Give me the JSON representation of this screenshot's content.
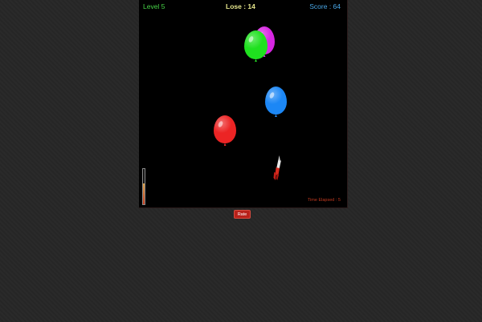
{
  "hud": {
    "level": "Level 5",
    "lose": "Lose : 14",
    "score": "Score : 64"
  },
  "colors": {
    "level": "#47d547",
    "lose": "#e6e68c",
    "score": "#4aa8e8",
    "time": "#c0391f",
    "rate_button": "#b8211a"
  },
  "balloons": [
    {
      "name": "magenta-balloon",
      "color": "#d726e2"
    },
    {
      "name": "green-balloon",
      "color": "#1fe11f"
    },
    {
      "name": "blue-balloon",
      "color": "#1c87f5"
    },
    {
      "name": "red-balloon",
      "color": "#ec2424"
    }
  ],
  "dart": {
    "icon": "dart-icon"
  },
  "power_meter": {
    "level": 0.58
  },
  "time_elapsed": "Time Elapsed : 5",
  "rate_button": {
    "label": "Rate"
  }
}
